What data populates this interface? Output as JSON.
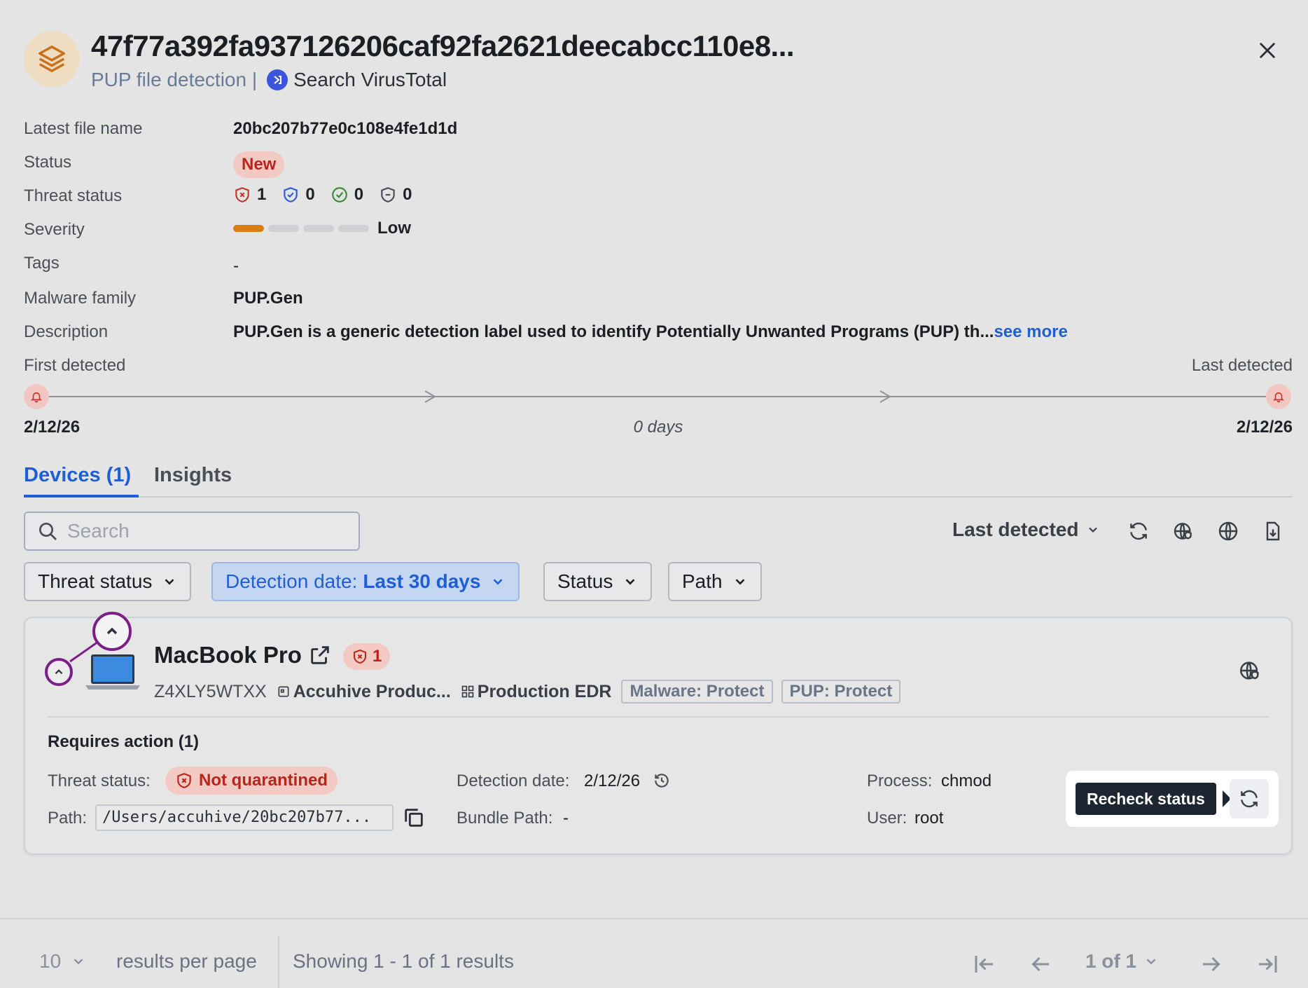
{
  "header": {
    "title": "47f77a392fa937126206caf92fa2621deecabcc110e8...",
    "subtitle": "PUP file detection |",
    "virustotal_label": "Search VirusTotal",
    "icon": "layers-icon",
    "close_icon": "close-icon"
  },
  "details": {
    "latest_file_name_label": "Latest file name",
    "latest_file_name": "20bc207b77e0c108e4fe1d1d",
    "status_label": "Status",
    "status_value": "New",
    "threat_status_label": "Threat status",
    "threat_counts": [
      {
        "icon": "shield-x-icon",
        "count": "1",
        "color": "#c0392b"
      },
      {
        "icon": "shield-check-blue-icon",
        "count": "0",
        "color": "#2d5bd8"
      },
      {
        "icon": "check-circle-icon",
        "count": "0",
        "color": "#3a8a3a"
      },
      {
        "icon": "shield-minus-icon",
        "count": "0",
        "color": "#4a4f57"
      }
    ],
    "severity_label": "Severity",
    "severity_level": 1,
    "severity_max": 4,
    "severity_value": "Low",
    "tags_label": "Tags",
    "tags_value": "-",
    "malware_family_label": "Malware family",
    "malware_family": "PUP.Gen",
    "description_label": "Description",
    "description": "PUP.Gen is a generic detection label used to identify Potentially Unwanted Programs (PUP) th...",
    "see_more": "see more"
  },
  "timeline": {
    "first_label": "First detected",
    "last_label": "Last detected",
    "first_date": "2/12/26",
    "last_date": "2/12/26",
    "duration": "0 days"
  },
  "tabs": [
    {
      "label": "Devices (1)",
      "active": true
    },
    {
      "label": "Insights",
      "active": false
    }
  ],
  "toolbar": {
    "search_placeholder": "Search",
    "sort_label": "Last detected",
    "icons": [
      "refresh-icon",
      "globe-shield-icon",
      "globe-icon",
      "export-file-icon"
    ]
  },
  "filters": {
    "threat_status": "Threat status",
    "detection_date_label": "Detection date:",
    "detection_date_value": "Last 30 days",
    "status": "Status",
    "path": "Path"
  },
  "device": {
    "name": "MacBook Pro",
    "threat_count": "1",
    "serial": "Z4XLY5WTXX",
    "group": "Accuhive Produc...",
    "policy": "Production EDR",
    "tags": [
      "Malware: Protect",
      "PUP: Protect"
    ],
    "requires_action": "Requires action (1)",
    "threat_status_label": "Threat status:",
    "threat_status_value": "Not quarantined",
    "detection_date_label": "Detection date:",
    "detection_date_value": "2/12/26",
    "process_label": "Process:",
    "process_value": "chmod",
    "path_label": "Path:",
    "path_value": "/Users/accuhive/20bc207b77...",
    "bundle_path_label": "Bundle Path:",
    "bundle_path_value": "-",
    "user_label": "User:",
    "user_value": "root",
    "tooltip": "Recheck status"
  },
  "footer": {
    "per_page_value": "10",
    "per_page_label": "results per page",
    "showing": "Showing 1 - 1 of 1 results",
    "page": "1 of 1"
  },
  "colors": {
    "accent": "#1f5fd6",
    "danger": "#b8261b",
    "severity_low": "#d97e12",
    "annotation": "#7b1f86"
  }
}
